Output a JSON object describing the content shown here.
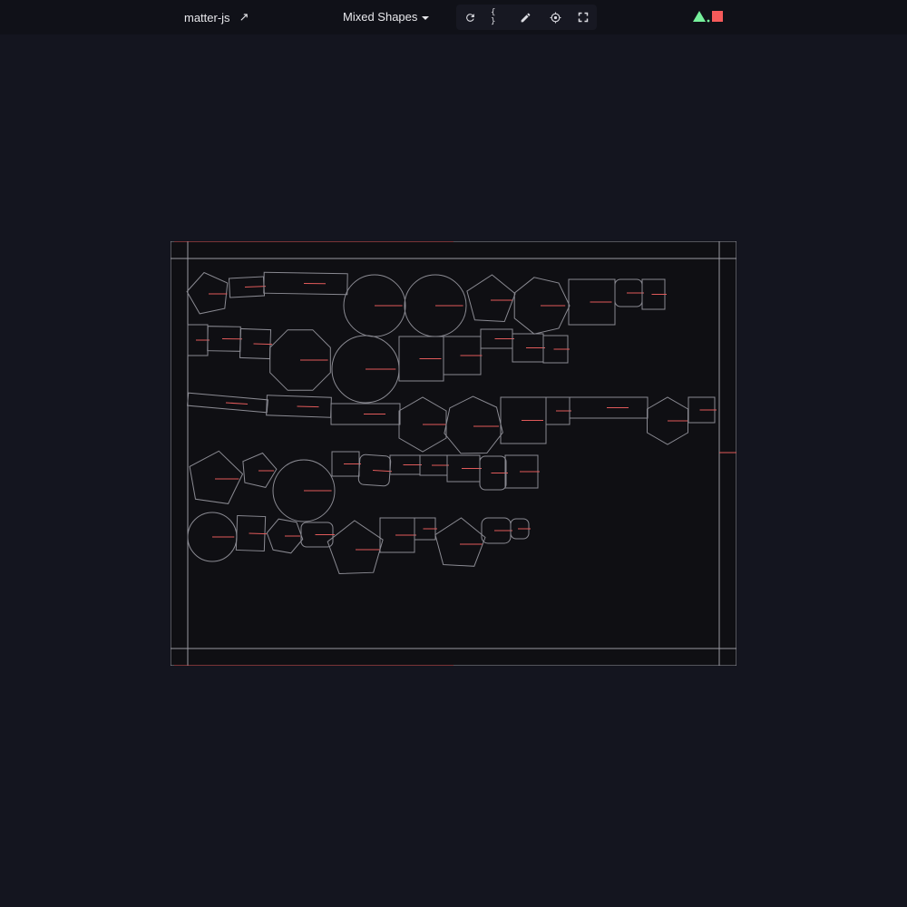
{
  "header": {
    "brand": "matter-js",
    "example": "Mixed Shapes",
    "tools": [
      {
        "name": "reset-icon"
      },
      {
        "name": "source-code-icon",
        "glyph": "{ }"
      },
      {
        "name": "edit-pencil-icon"
      },
      {
        "name": "inspector-target-icon"
      },
      {
        "name": "fullscreen-icon"
      }
    ],
    "logo_colors": [
      "#76f09b",
      "#f55a5a"
    ]
  },
  "colors": {
    "background": "#14151f",
    "topbar": "#101118",
    "canvas": "#0f0f13",
    "outline": "#8a8a92",
    "velocity": "#e05a5a"
  }
}
